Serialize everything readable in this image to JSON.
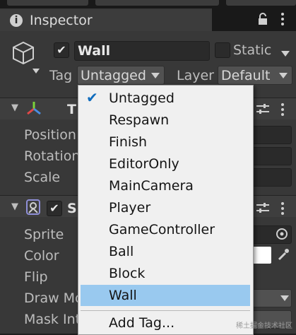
{
  "window": {
    "tab_title": "Inspector"
  },
  "gameobject": {
    "name": "Wall",
    "static_label": "Static",
    "tag_label": "Tag",
    "tag_value": "Untagged",
    "layer_label": "Layer",
    "layer_value": "Default"
  },
  "transform": {
    "title": "T",
    "fields": [
      "Position",
      "Rotation",
      "Scale"
    ]
  },
  "sprite_renderer": {
    "title": "S",
    "fields": [
      "Sprite",
      "Color",
      "Flip",
      "Draw Mo",
      "Mask Int"
    ]
  },
  "tag_dropdown": {
    "items": [
      "Untagged",
      "Respawn",
      "Finish",
      "EditorOnly",
      "MainCamera",
      "Player",
      "GameController",
      "Ball",
      "Block",
      "Wall"
    ],
    "checked": "Untagged",
    "highlighted": "Wall",
    "add_tag_label": "Add Tag..."
  },
  "watermark": "稀土掘金技术社区",
  "icons": {
    "inspector": "info-icon",
    "lock": "lock-icon",
    "menu": "kebab-menu-icon",
    "gameobject": "cube-icon",
    "transform": "transform-axes-icon",
    "sprite": "sprite-renderer-icon",
    "settings": "sliders-icon",
    "target": "object-picker-icon",
    "eyedropper": "eyedropper-icon"
  }
}
